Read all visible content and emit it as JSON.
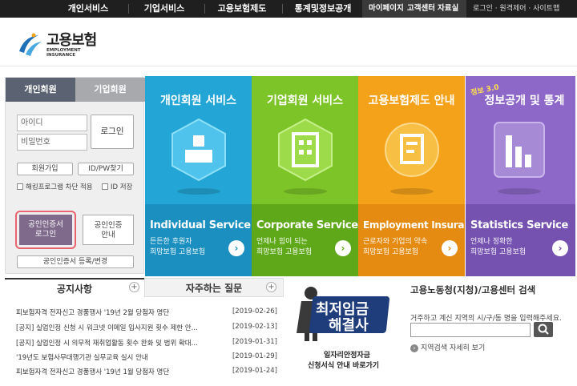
{
  "topnav": {
    "items": [
      "개인서비스",
      "기업서비스",
      "고용보험제도",
      "통계및정보공개"
    ],
    "mypage": "마이페이지",
    "customer": "고객센터",
    "data": "자료실",
    "util": "로그인 · 원격제어 · 사이트맵"
  },
  "logo": {
    "title": "고용보험",
    "subtitle": "EMPLOYMENT INSURANCE"
  },
  "login": {
    "tab_personal": "개인회원",
    "tab_corporate": "기업회원",
    "id_placeholder": "아이디",
    "pw_placeholder": "비밀번호",
    "login_button": "로그인",
    "join": "회원가입",
    "find": "ID/PW찾기",
    "hacking": "해킹프로그램 차단 적용",
    "save_id": "ID 저장",
    "cert_login_1": "공인인증서",
    "cert_login_2": "로그인",
    "cert_guide_1": "공인인증",
    "cert_guide_2": "안내",
    "cert_register": "공인인증서 등록/변경"
  },
  "services": [
    {
      "title": "개인회원 서비스",
      "en": "Individual Service",
      "desc1": "든든한 후원자",
      "desc2": "희망보험 고용보험",
      "color": "#23a6d5",
      "lower": "#1a8fc0"
    },
    {
      "title": "기업회원 서비스",
      "en": "Corporate Service",
      "desc1": "언제나 힘이 되는",
      "desc2": "희망보험 고용보험",
      "color": "#7cc427",
      "lower": "#5fa81a"
    },
    {
      "title": "고용보험제도 안내",
      "en": "Employment Insurance",
      "desc1": "근로자와 기업의 약속",
      "desc2": "희망보험 고용보험",
      "color": "#f3a21a",
      "lower": "#e58b11"
    },
    {
      "title": "정보공개 및 통계",
      "badge": "정보 3.0",
      "en": "Statistics Service",
      "desc1": "언제나 정확한",
      "desc2": "희망보험 고용보험",
      "color": "#8e68c8",
      "lower": "#7551b0"
    }
  ],
  "notice": {
    "tab1": "공지사항",
    "tab2": "자주하는 질문",
    "items": [
      {
        "title": "피보험자격 전자신고 경품행사 '19년 2월 당첨자 명단",
        "date": "[2019-02-26]"
      },
      {
        "title": "[공지] 실업인정 신청 시 워크넷 이메일 입사지원 횟수 제한 안...",
        "date": "[2019-02-13]"
      },
      {
        "title": "[공지] 실업인정 시 의무적 재취업활동 횟수 완화 및 범위 확대...",
        "date": "[2019-01-31]"
      },
      {
        "title": "'19년도 보험사무대행기관 실무교육 실시 안내",
        "date": "[2019-01-29]"
      },
      {
        "title": "피보험자격 전자신고 경품행사 '19년 1월 당첨자 명단",
        "date": "[2019-01-24]"
      }
    ]
  },
  "banner": {
    "line1": "최저임금",
    "line2": "해결사",
    "line3": "일자리안정자금",
    "line4": "신청서식 안내 바로가기"
  },
  "search": {
    "title": "고용노동청(지청)/고용센터 검색",
    "desc": "거주하고 계신 지역의 시/구/동 명을 입력해주세요.",
    "detail": "지역검색 자세히 보기"
  }
}
